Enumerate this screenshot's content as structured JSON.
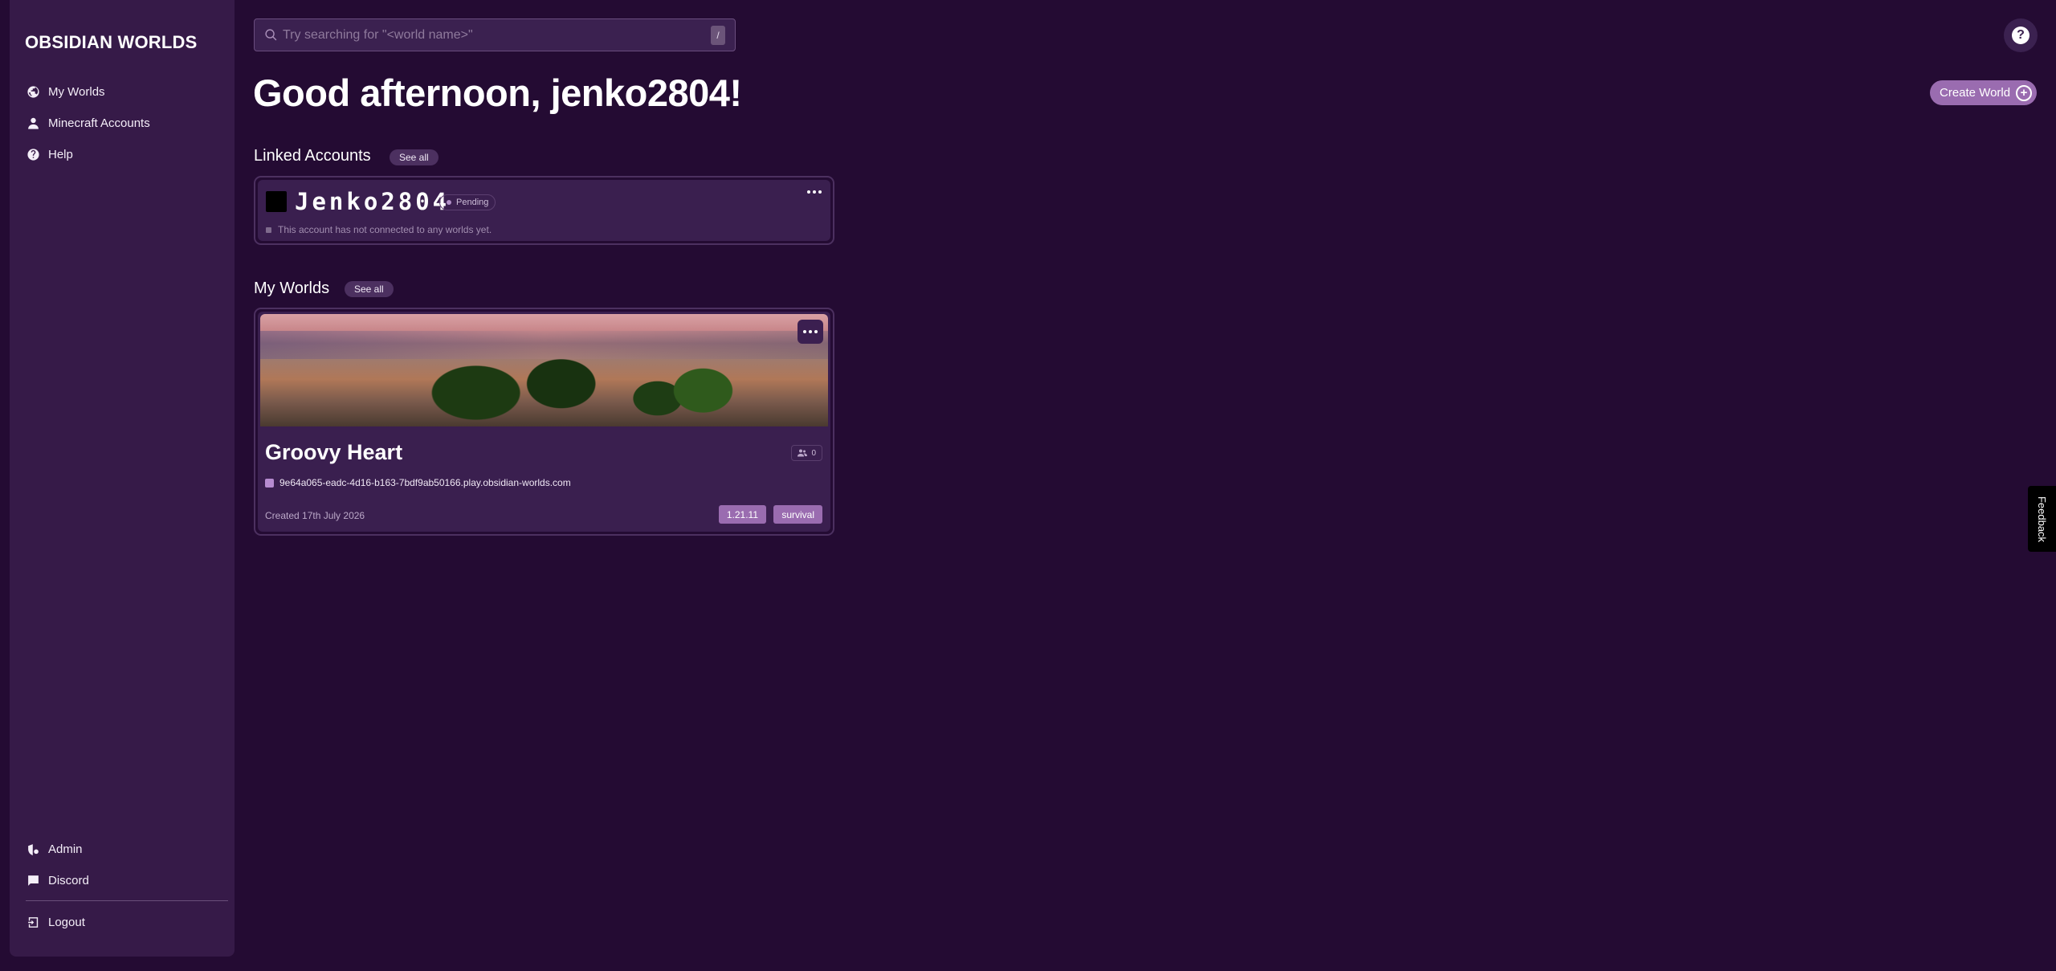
{
  "brand": "OBSIDIAN WORLDS",
  "sidebar": {
    "items": [
      {
        "label": "My Worlds",
        "icon": "globe-icon"
      },
      {
        "label": "Minecraft Accounts",
        "icon": "user-icon"
      },
      {
        "label": "Help",
        "icon": "help-circle-icon"
      }
    ],
    "bottom_items": [
      {
        "label": "Admin",
        "icon": "admin-icon"
      },
      {
        "label": "Discord",
        "icon": "chat-icon"
      },
      {
        "label": "Logout",
        "icon": "logout-icon"
      }
    ]
  },
  "search": {
    "placeholder": "Try searching for \"<world name>\"",
    "shortcut": "/"
  },
  "help_button": "?",
  "greeting": "Good afternoon, jenko2804!",
  "create_world": {
    "label": "Create World",
    "icon": "plus-circle-icon"
  },
  "linked_accounts": {
    "title": "Linked Accounts",
    "see_all": "See all",
    "accounts": [
      {
        "name": "Jenko2804",
        "status": "Pending",
        "note": "This account has not connected to any worlds yet."
      }
    ]
  },
  "my_worlds": {
    "title": "My Worlds",
    "see_all": "See all",
    "worlds": [
      {
        "name": "Groovy Heart",
        "players": "0",
        "address": "9e64a065-eadc-4d16-b163-7bdf9ab50166.play.obsidian-worlds.com",
        "created": "Created 17th July 2026",
        "version": "1.21.11",
        "mode": "survival"
      }
    ]
  },
  "feedback": "Feedback",
  "colors": {
    "background": "#240b33",
    "sidebar": "#361a48",
    "accent": "#9a6cb0",
    "card": "#3a1f4f"
  }
}
